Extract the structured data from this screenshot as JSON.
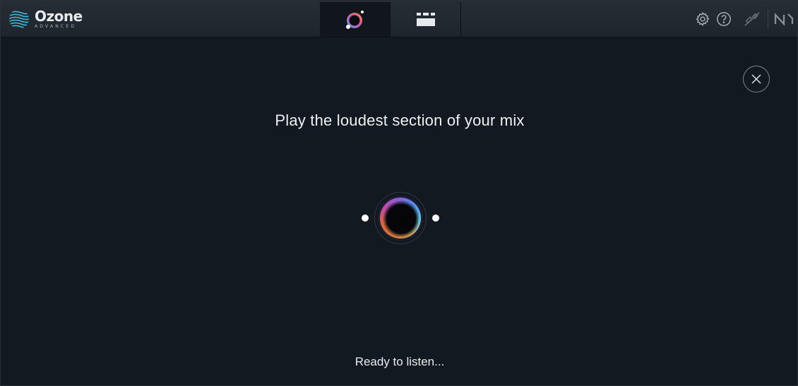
{
  "app": {
    "name": "Ozone",
    "edition": "ADVANCED"
  },
  "tabs": [
    {
      "id": "assistant",
      "icon": "master-assistant-orb-icon",
      "active": true
    },
    {
      "id": "modules",
      "icon": "modules-grid-icon",
      "active": false
    }
  ],
  "toolbar": {
    "icons": [
      "settings-icon",
      "help-icon",
      "link-disabled-icon",
      "native-instruments-logo-icon"
    ]
  },
  "assistant": {
    "prompt": "Play the loudest section of your mix",
    "status": "Ready to listen...",
    "close_icon": "close-icon"
  },
  "colors": {
    "background": "#131920",
    "topbar": "#232a31",
    "text": "#eef1f3",
    "logo_accent": "#3fb6d6"
  }
}
